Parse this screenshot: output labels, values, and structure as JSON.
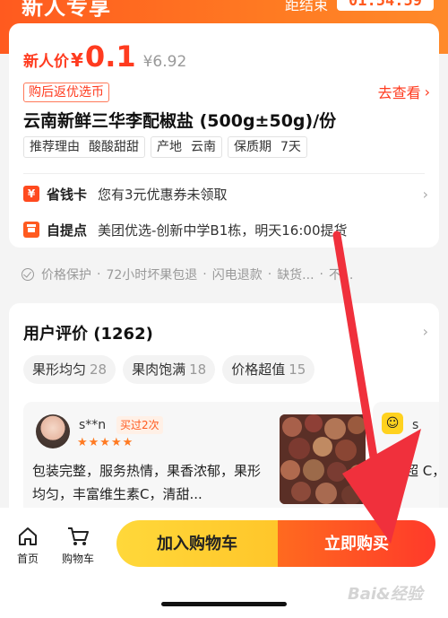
{
  "header": {
    "banner_title": "新人专享",
    "countdown_label": "距结束",
    "countdown": "01:54:59"
  },
  "product": {
    "new_price_label": "新人价",
    "currency": "¥",
    "price": "0.1",
    "original_price": "¥6.92",
    "rebate_badge": "购后返优选币",
    "goto_link": "去查看",
    "title": "云南新鲜三华李配椒盐 (500g±50g)/份",
    "tags": [
      {
        "key": "推荐理由",
        "value": "酸酸甜甜"
      },
      {
        "key": "产地",
        "value": "云南"
      },
      {
        "key": "保质期",
        "value": "7天"
      }
    ],
    "saver_card": {
      "icon": "¥",
      "label": "省钱卡",
      "value": "您有3元优惠券未领取"
    },
    "pickup": {
      "label": "自提点",
      "value": "美团优选-创新中学B1栋，明天16:00提货"
    }
  },
  "guarantee": {
    "items": [
      "价格保护",
      "72小时坏果包退",
      "闪电退款",
      "缺货...",
      "不..."
    ]
  },
  "reviews": {
    "title": "用户评价 (1262)",
    "chips": [
      {
        "label": "果形均匀",
        "count": "28"
      },
      {
        "label": "果肉饱满",
        "count": "18"
      },
      {
        "label": "价格超值",
        "count": "15"
      }
    ],
    "items": [
      {
        "user": "s**n",
        "badge": "买过2次",
        "stars": "★★★★★",
        "text": "包装完整，服务热情，果香浓郁，果形均匀，丰富维生素C，清甜..."
      },
      {
        "user": "s",
        "text": "质量超 C，包"
      }
    ]
  },
  "bottom_bar": {
    "home": "首页",
    "cart": "购物车",
    "add_to_cart": "加入购物车",
    "buy_now": "立即购买"
  },
  "watermark": "Bai&经验",
  "colors": {
    "accent": "#ff3b1f",
    "orange": "#ff6a1f",
    "yellow": "#ffd83a",
    "arrow": "#f0303c"
  }
}
